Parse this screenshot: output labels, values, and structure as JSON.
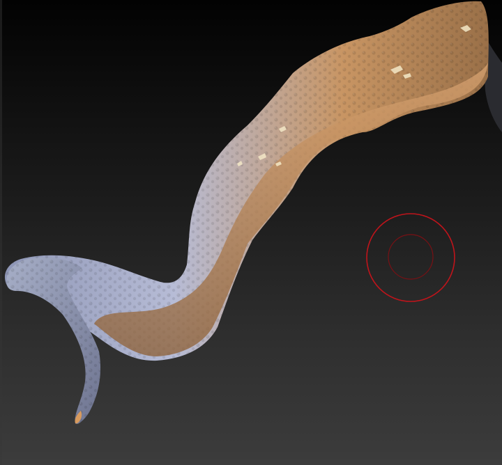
{
  "viewport": {
    "background_top": "#020202",
    "background_bottom": "#3c3c3c",
    "mesh_highlight_color": "#b9c2dd",
    "mesh_shadow_color": "#6a7191",
    "mesh_warm_color": "#c98f55",
    "brush_cursor_color": "#c0141b",
    "brush_inner_color": "#7a1014",
    "brush_cursor_icon": "brush-radius-circle"
  }
}
